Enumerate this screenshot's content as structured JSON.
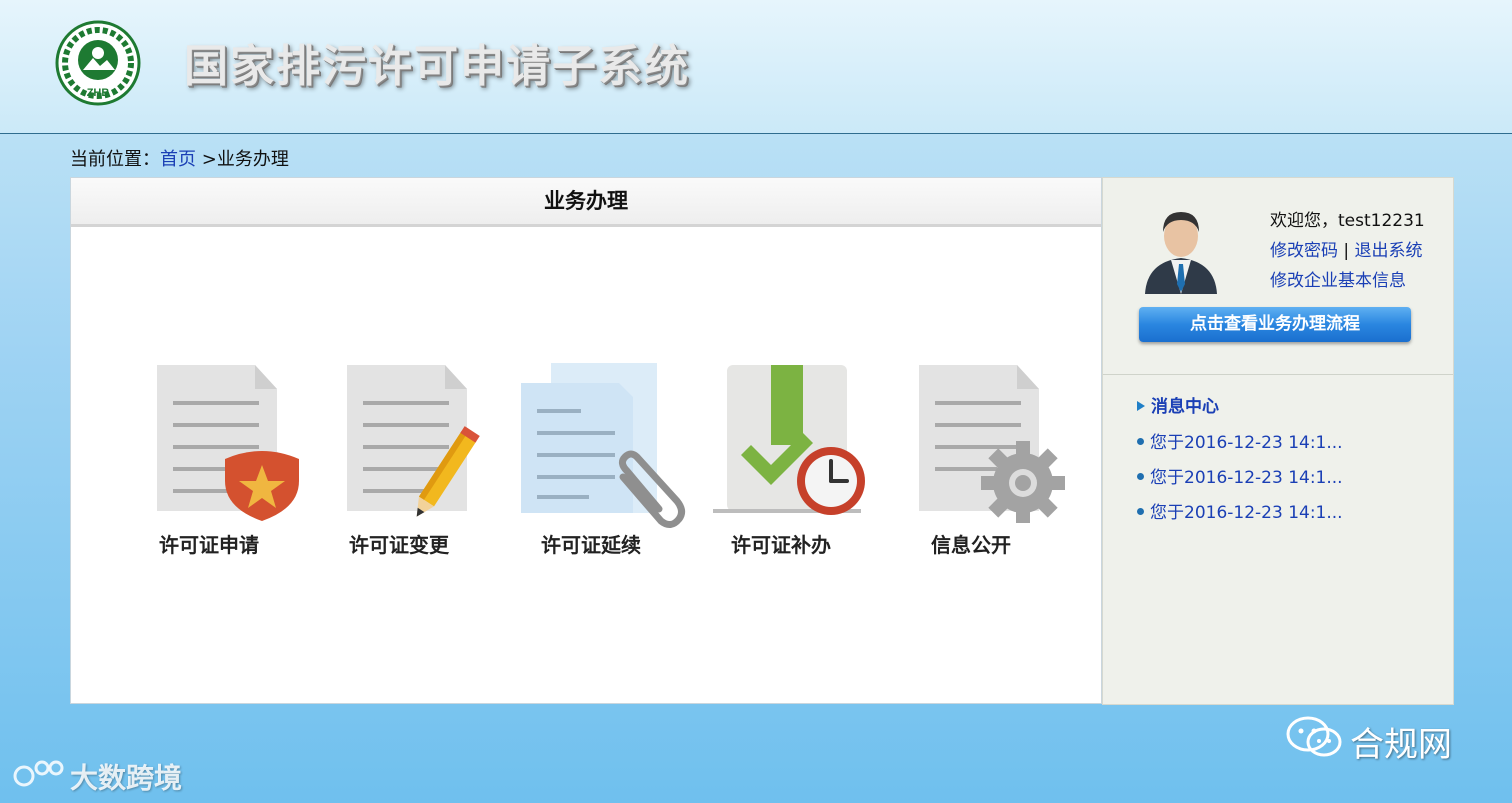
{
  "header": {
    "title": "国家排污许可申请子系统",
    "logo_text": "ZHB"
  },
  "breadcrumb": {
    "prefix": "当前位置：",
    "home": "首页",
    "current": ">业务办理"
  },
  "main": {
    "title": "业务办理",
    "services": [
      {
        "label": "许可证申请",
        "icon": "shield-star-icon"
      },
      {
        "label": "许可证变更",
        "icon": "pencil-icon"
      },
      {
        "label": "许可证延续",
        "icon": "paperclip-icon"
      },
      {
        "label": "许可证补办",
        "icon": "clock-icon"
      },
      {
        "label": "信息公开",
        "icon": "gear-icon"
      }
    ]
  },
  "sidebar": {
    "welcome": "欢迎您，test12231",
    "change_password": "修改密码",
    "separator": "|",
    "logout": "退出系统",
    "edit_company": "修改企业基本信息",
    "flow_button": "点击查看业务办理流程",
    "message_center": "消息中心",
    "messages": [
      "您于2016-12-23 14:1...",
      "您于2016-12-23 14:1...",
      "您于2016-12-23 14:1..."
    ]
  },
  "watermarks": {
    "wechat": "合规网",
    "brand": "大数跨境"
  },
  "colors": {
    "link": "#1a3fb5",
    "button": "#2a86e0",
    "background": "#9fd3f3"
  }
}
